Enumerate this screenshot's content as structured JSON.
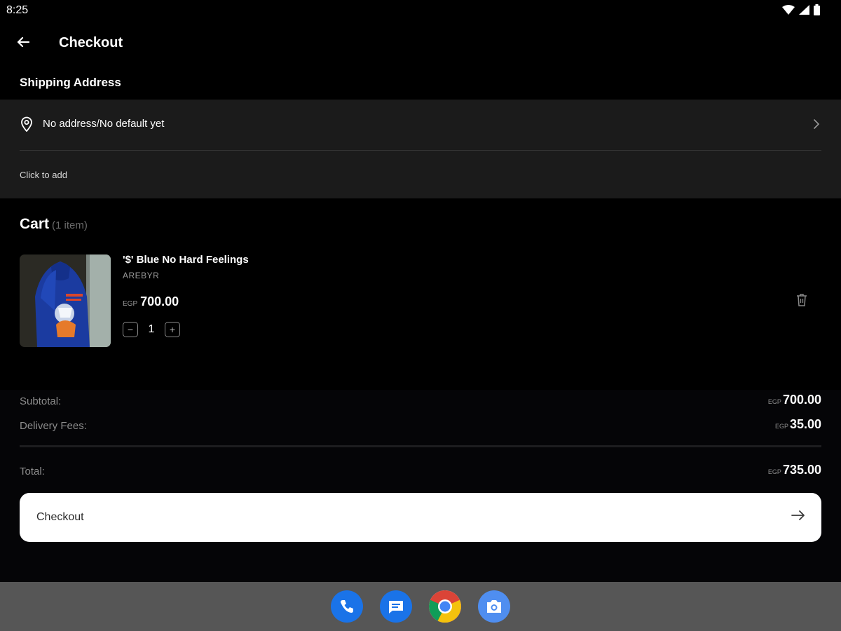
{
  "status_bar": {
    "time": "8:25",
    "icons": [
      "wifi-icon",
      "signal-icon",
      "battery-icon"
    ]
  },
  "app_bar": {
    "title": "Checkout",
    "back_icon": "arrow-left-icon"
  },
  "shipping": {
    "heading": "Shipping Address",
    "address_text": "No address/No default yet",
    "hint": "Click to add",
    "icons": [
      "location-pin-icon",
      "chevron-right-icon"
    ]
  },
  "cart": {
    "title": "Cart",
    "count_label": "(1 item)",
    "items": [
      {
        "name": "'$' Blue No Hard Feelings",
        "brand": "AREBYR",
        "currency": "EGP",
        "price": "700.00",
        "quantity": "1",
        "decrement_symbol": "−",
        "increment_symbol": "+"
      }
    ]
  },
  "summary": {
    "subtotal_label": "Subtotal:",
    "subtotal_currency": "EGP",
    "subtotal_value": "700.00",
    "delivery_label": "Delivery Fees:",
    "delivery_currency": "EGP",
    "delivery_value": "35.00",
    "total_label": "Total:",
    "total_currency": "EGP",
    "total_value": "735.00"
  },
  "checkout_button": {
    "label": "Checkout",
    "icon": "arrow-right-icon"
  },
  "dock": {
    "apps": [
      "phone-app-icon",
      "messages-app-icon",
      "chrome-app-icon",
      "camera-app-icon"
    ]
  },
  "colors": {
    "background": "#000000",
    "card": "#1b1b1b",
    "button": "#ffffff",
    "dock": "#565656",
    "dock_app_blue": "#1a73e8"
  }
}
